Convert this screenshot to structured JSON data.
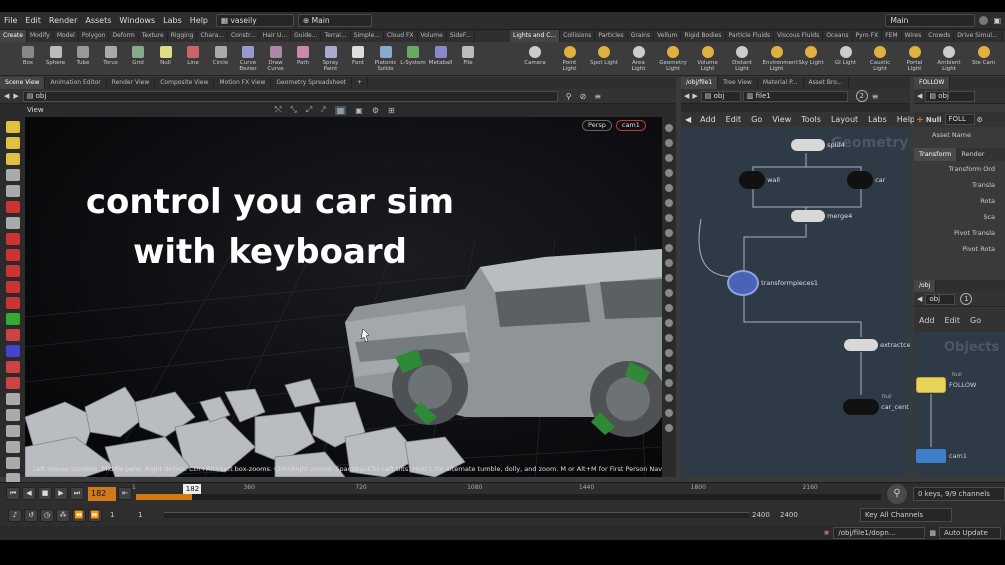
{
  "menubar": {
    "items": [
      "File",
      "Edit",
      "Render",
      "Assets",
      "Windows",
      "Labs",
      "Help"
    ],
    "desktop": "vaseily",
    "context": "Main",
    "right_context": "Main"
  },
  "shelf_tabs_left": [
    "Create",
    "Modify",
    "Model",
    "Polygon",
    "Deform",
    "Texture",
    "Rigging",
    "Chara...",
    "Constr...",
    "Hair U...",
    "Guide...",
    "Terrai...",
    "Simple...",
    "Cloud FX",
    "Volume",
    "SideF..."
  ],
  "shelf_tabs_right": [
    "Lights and C...",
    "Collisions",
    "Particles",
    "Grains",
    "Vellum",
    "Rigid Bodies",
    "Particle Fluids",
    "Viscous Fluids",
    "Oceans",
    "Pyro FX",
    "FEM",
    "Wires",
    "Crowds",
    "Drive Simul..."
  ],
  "shelf_tools_left": [
    "Box",
    "Sphere",
    "Tube",
    "Torus",
    "Grid",
    "Null",
    "Line",
    "Circle",
    "Curve Bezier",
    "Draw Curve",
    "Path",
    "Spray Paint",
    "Font",
    "Platonic Solids",
    "L-System",
    "Metaball",
    "File"
  ],
  "shelf_tools_right": [
    "Camera",
    "Point Light",
    "Spot Light",
    "Area Light",
    "Geometry Light",
    "Volume Light",
    "Distant Light",
    "Environment Light",
    "Sky Light",
    "GI Light",
    "Caustic Light",
    "Portal Light",
    "Ambient Light",
    "Ste Cam"
  ],
  "viewport_tabs": [
    "Scene View",
    "Animation Editor",
    "Render View",
    "Composite View",
    "Motion FX View",
    "Geometry Spreadsheet"
  ],
  "viewport_path": "obj",
  "viewport_title": "View",
  "persp_label": "Persp",
  "cam_label": "cam1",
  "overlay_text": {
    "line1": "control you car sim",
    "line2": "with keyboard"
  },
  "status_text": "Left mouse tumbles. Middle pans. Right dollies. Ctrl+Alt+Left box-zooms. Ctrl+Right zooms. Spacebar-Ctrl-Left tilts. Hold L for alternate tumble, dolly, and zoom.     M or Alt+M for First Person Navigation.",
  "network_tabs": [
    "/obj/file1",
    "Tree View",
    "Material P...",
    "Asset Bro..."
  ],
  "network_path": {
    "root": "obj",
    "node": "file1",
    "badge": "2"
  },
  "network_menu": [
    "Add",
    "Edit",
    "Go",
    "View",
    "Tools",
    "Layout",
    "Labs",
    "Help"
  ],
  "network_watermark": "Geometry",
  "nodes": {
    "split": "split4",
    "wall": "wall",
    "car": "car",
    "merge": "merge4",
    "transform": "transformpieces1",
    "extract": "extractce",
    "null_tag": "Null",
    "carcenter": "car_cent"
  },
  "param_tabs": [
    "FOLLOW"
  ],
  "params": {
    "node_type": "Null",
    "node_name": "FOLL",
    "asset_name": "Asset Name",
    "tabs": [
      "Transform",
      "Render"
    ],
    "labels": [
      "Transform Ord",
      "Transla",
      "Rota",
      "Sca",
      "Pivot Transla",
      "Pivot Rota"
    ]
  },
  "objects_pane": {
    "path": "obj",
    "badge": "1",
    "menu": [
      "Add",
      "Edit",
      "Go"
    ],
    "watermark": "Objects",
    "follow_tag": "Null",
    "follow_label": "FOLLOW",
    "cam_label": "cam1"
  },
  "timeline": {
    "current_frame": "182",
    "ticks": [
      "1",
      "360",
      "720",
      "1080",
      "1440",
      "1800",
      "2160"
    ],
    "start": "1",
    "start2": "1",
    "end": "2400",
    "end2": "2400",
    "keys_info": "0 keys, 9/9 channels",
    "key_mode": "Key All Channels",
    "progress": 0.0758
  },
  "bottom": {
    "path": "/obj/file1/dopn...",
    "update_mode": "Auto Update"
  }
}
